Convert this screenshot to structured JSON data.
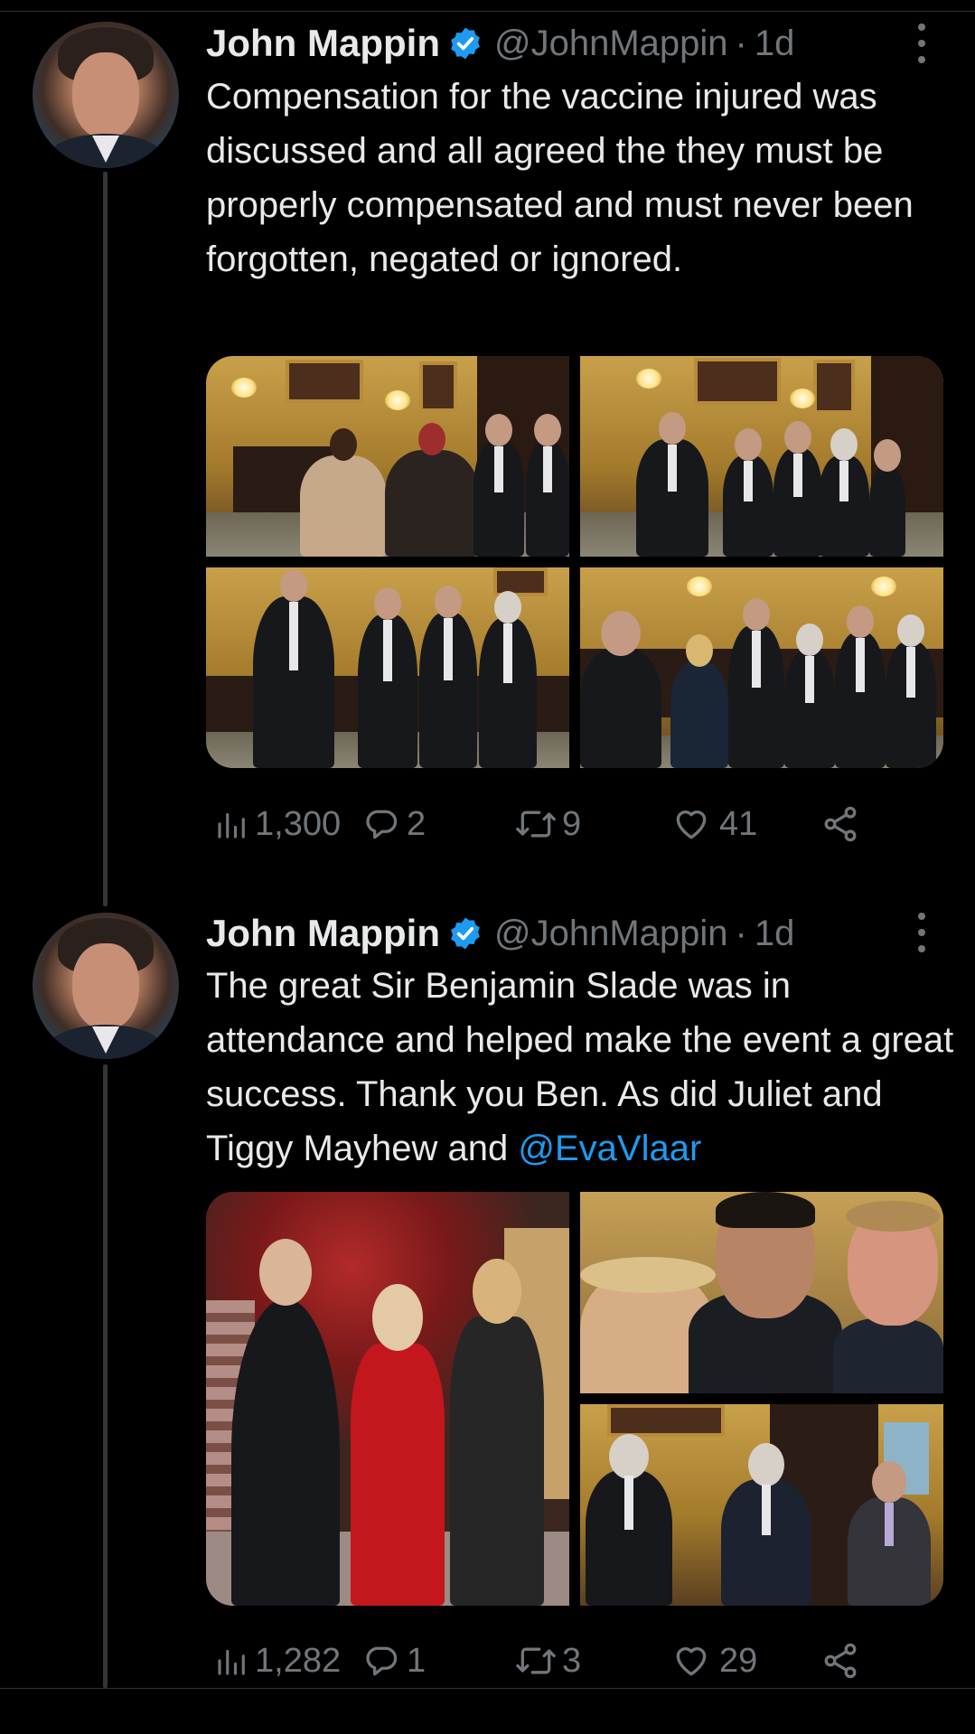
{
  "tweets": [
    {
      "name": "John Mappin",
      "handle": "@JohnMappin",
      "separator": "·",
      "time": "1d",
      "text": "Compensation for the vaccine injured was discussed and all agreed the they must be properly compensated and must never been forgotten, negated or ignored.",
      "mention": "",
      "stats": {
        "views": "1,300",
        "replies": "2",
        "retweets": "9",
        "likes": "41"
      }
    },
    {
      "name": "John Mappin",
      "handle": "@JohnMappin",
      "separator": "·",
      "time": "1d",
      "text": "The great Sir Benjamin Slade was in attendance and helped make the event a great success. Thank you Ben.  As did Juliet and Tiggy Mayhew and ",
      "mention": "@EvaVlaar",
      "stats": {
        "views": "1,282",
        "replies": "1",
        "retweets": "3",
        "likes": "29"
      }
    }
  ],
  "colors": {
    "background": "#000000",
    "text": "#e7e9ea",
    "secondary": "#71767b",
    "accent": "#1d9bf0",
    "thread_line": "#333639"
  },
  "icons": [
    "verified-badge-icon",
    "more-icon",
    "views-icon",
    "reply-icon",
    "retweet-icon",
    "like-icon",
    "share-icon"
  ]
}
